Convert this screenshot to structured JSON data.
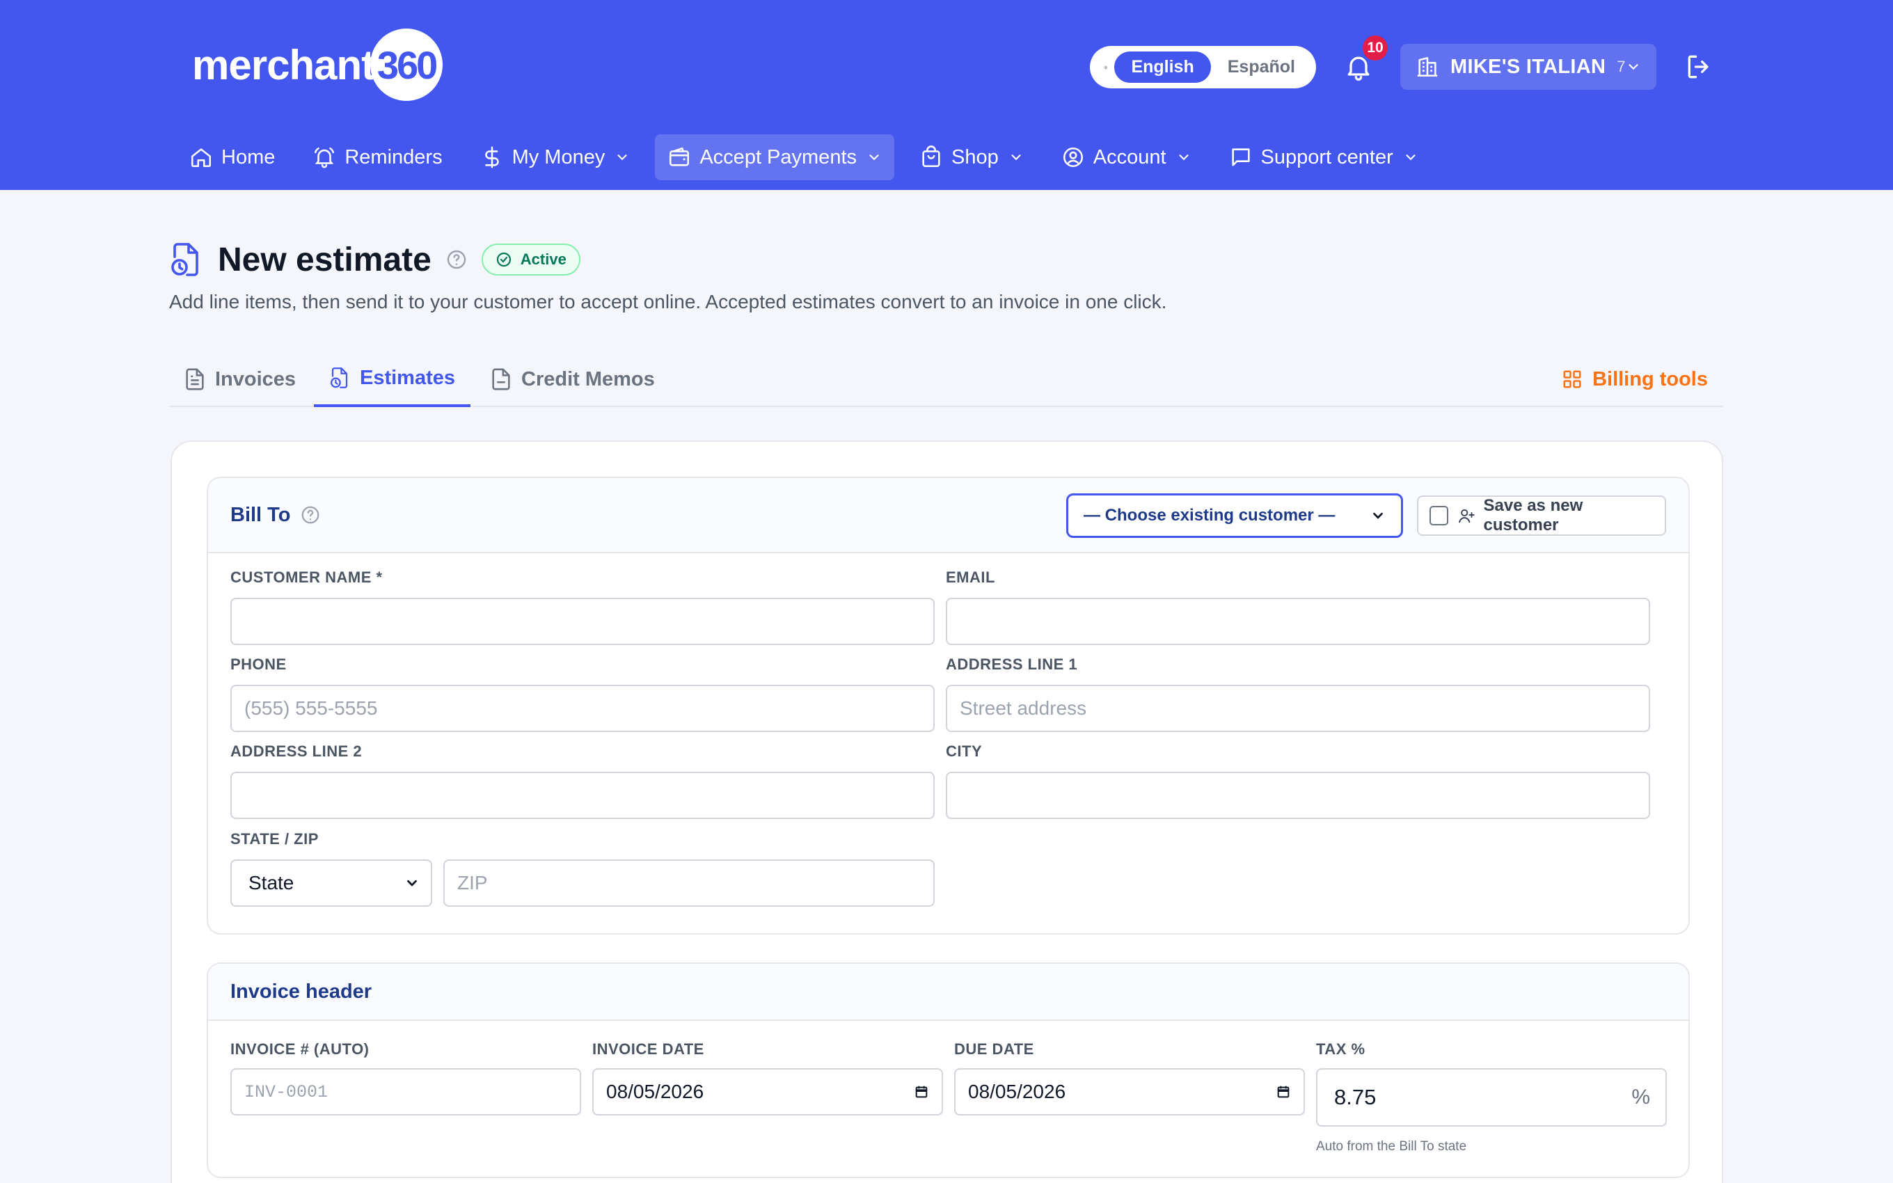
{
  "brand": {
    "logo_text": "merchant",
    "logo_badge": "360"
  },
  "language": {
    "options": [
      "English",
      "Español"
    ],
    "active": "English"
  },
  "notifications": {
    "count": "10"
  },
  "merchant": {
    "name": "MIKE'S ITALIAN",
    "count": "7"
  },
  "nav": [
    {
      "label": "Home",
      "icon": "home-icon",
      "dropdown": false
    },
    {
      "label": "Reminders",
      "icon": "bell-ring-icon",
      "dropdown": false
    },
    {
      "label": "My Money",
      "icon": "dollar-icon",
      "dropdown": true
    },
    {
      "label": "Accept Payments",
      "icon": "wallet-icon",
      "dropdown": true,
      "active": true
    },
    {
      "label": "Shop",
      "icon": "shopping-bag-icon",
      "dropdown": true
    },
    {
      "label": "Account",
      "icon": "user-circle-icon",
      "dropdown": true
    },
    {
      "label": "Support center",
      "icon": "message-square-icon",
      "dropdown": true
    }
  ],
  "page": {
    "title": "New estimate",
    "status": "Active",
    "subtitle": "Add line items, then send it to your customer to accept online. Accepted estimates convert to an invoice in one click."
  },
  "tabs": [
    {
      "label": "Invoices",
      "icon": "file-text-icon"
    },
    {
      "label": "Estimates",
      "icon": "estimate-icon",
      "active": true
    },
    {
      "label": "Credit Memos",
      "icon": "file-icon"
    }
  ],
  "billing_tools": "Billing tools",
  "bill_to": {
    "title": "Bill To",
    "customer_select": "— Choose existing customer —",
    "save_new": "Save as new customer",
    "fields": {
      "customer_name": {
        "label": "CUSTOMER NAME *",
        "value": "",
        "placeholder": ""
      },
      "email": {
        "label": "EMAIL",
        "value": "",
        "placeholder": ""
      },
      "phone": {
        "label": "PHONE",
        "value": "",
        "placeholder": "(555) 555-5555"
      },
      "address1": {
        "label": "ADDRESS LINE 1",
        "value": "",
        "placeholder": "Street address"
      },
      "address2": {
        "label": "ADDRESS LINE 2",
        "value": "",
        "placeholder": ""
      },
      "city": {
        "label": "CITY",
        "value": "",
        "placeholder": ""
      },
      "state_zip": {
        "label": "STATE / ZIP",
        "state": "State",
        "zip_placeholder": "ZIP"
      }
    }
  },
  "invoice_header": {
    "title": "Invoice header",
    "invoice_no": {
      "label": "INVOICE # (AUTO)",
      "placeholder": "INV-0001"
    },
    "invoice_date": {
      "label": "INVOICE DATE",
      "value": "08/05/2026"
    },
    "due_date": {
      "label": "DUE DATE",
      "value": "08/05/2026"
    },
    "tax": {
      "label": "TAX %",
      "value": "8.75",
      "suffix": "%",
      "hint": "Auto from the Bill To state"
    }
  },
  "colors": {
    "primary": "#4356ee",
    "accent": "#f97316",
    "success": "#047857",
    "badge": "#e11d48"
  }
}
